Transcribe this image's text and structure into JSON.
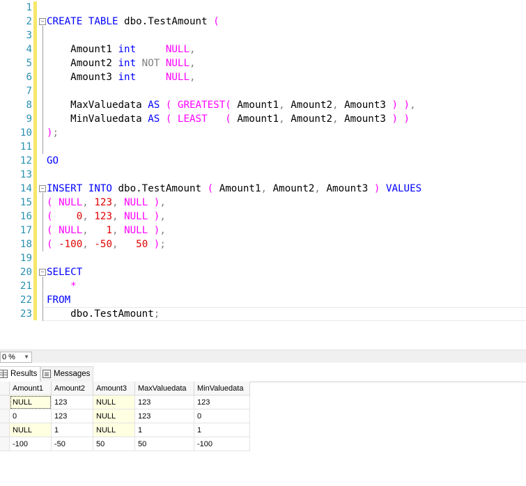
{
  "editor": {
    "lines": [
      {
        "n": "1",
        "fold": false,
        "tokens": []
      },
      {
        "n": "2",
        "fold": true,
        "tokens": [
          [
            "kw",
            "CREATE TABLE "
          ],
          [
            "id",
            "dbo.TestAmount "
          ],
          [
            "pk",
            "("
          ]
        ]
      },
      {
        "n": "3",
        "fold": false,
        "tokens": []
      },
      {
        "n": "4",
        "fold": false,
        "tokens": [
          [
            "id",
            "    Amount1 "
          ],
          [
            "kw",
            "int     "
          ],
          [
            "pk",
            "NULL"
          ],
          [
            "gr",
            ","
          ]
        ]
      },
      {
        "n": "5",
        "fold": false,
        "tokens": [
          [
            "id",
            "    Amount2 "
          ],
          [
            "kw",
            "int "
          ],
          [
            "gr",
            "NOT "
          ],
          [
            "pk",
            "NULL"
          ],
          [
            "gr",
            ","
          ]
        ]
      },
      {
        "n": "6",
        "fold": false,
        "tokens": [
          [
            "id",
            "    Amount3 "
          ],
          [
            "kw",
            "int     "
          ],
          [
            "pk",
            "NULL"
          ],
          [
            "gr",
            ","
          ]
        ]
      },
      {
        "n": "7",
        "fold": false,
        "tokens": []
      },
      {
        "n": "8",
        "fold": false,
        "tokens": [
          [
            "id",
            "    MaxValuedata "
          ],
          [
            "kw",
            "AS "
          ],
          [
            "pk",
            "( GREATEST( "
          ],
          [
            "id",
            "Amount1"
          ],
          [
            "gr",
            ", "
          ],
          [
            "id",
            "Amount2"
          ],
          [
            "gr",
            ", "
          ],
          [
            "id",
            "Amount3 "
          ],
          [
            "pk",
            ") )"
          ],
          [
            "gr",
            ","
          ]
        ]
      },
      {
        "n": "9",
        "fold": false,
        "tokens": [
          [
            "id",
            "    MinValuedata "
          ],
          [
            "kw",
            "AS "
          ],
          [
            "pk",
            "( LEAST   ( "
          ],
          [
            "id",
            "Amount1"
          ],
          [
            "gr",
            ", "
          ],
          [
            "id",
            "Amount2"
          ],
          [
            "gr",
            ", "
          ],
          [
            "id",
            "Amount3 "
          ],
          [
            "pk",
            ") )"
          ]
        ]
      },
      {
        "n": "10",
        "fold": false,
        "tokens": [
          [
            "pk",
            ")"
          ],
          [
            "gr",
            ";"
          ]
        ]
      },
      {
        "n": "11",
        "fold": false,
        "tokens": []
      },
      {
        "n": "12",
        "fold": false,
        "tokens": [
          [
            "kw",
            "GO"
          ]
        ]
      },
      {
        "n": "13",
        "fold": false,
        "tokens": []
      },
      {
        "n": "14",
        "fold": true,
        "tokens": [
          [
            "kw",
            "INSERT INTO "
          ],
          [
            "id",
            "dbo.TestAmount "
          ],
          [
            "pk",
            "( "
          ],
          [
            "id",
            "Amount1"
          ],
          [
            "gr",
            ", "
          ],
          [
            "id",
            "Amount2"
          ],
          [
            "gr",
            ", "
          ],
          [
            "id",
            "Amount3 "
          ],
          [
            "pk",
            ") "
          ],
          [
            "kw",
            "VALUES"
          ]
        ]
      },
      {
        "n": "15",
        "fold": false,
        "tokens": [
          [
            "pk",
            "( "
          ],
          [
            "pk",
            "NULL"
          ],
          [
            "gr",
            ", "
          ],
          [
            "nm",
            "123"
          ],
          [
            "gr",
            ", "
          ],
          [
            "pk",
            "NULL "
          ],
          [
            "pk",
            ")"
          ],
          [
            "gr",
            ","
          ]
        ]
      },
      {
        "n": "16",
        "fold": false,
        "tokens": [
          [
            "pk",
            "(    "
          ],
          [
            "nm",
            "0"
          ],
          [
            "gr",
            ", "
          ],
          [
            "nm",
            "123"
          ],
          [
            "gr",
            ", "
          ],
          [
            "pk",
            "NULL "
          ],
          [
            "pk",
            ")"
          ],
          [
            "gr",
            ","
          ]
        ]
      },
      {
        "n": "17",
        "fold": false,
        "tokens": [
          [
            "pk",
            "( "
          ],
          [
            "pk",
            "NULL"
          ],
          [
            "gr",
            ",   "
          ],
          [
            "nm",
            "1"
          ],
          [
            "gr",
            ", "
          ],
          [
            "pk",
            "NULL "
          ],
          [
            "pk",
            ")"
          ],
          [
            "gr",
            ","
          ]
        ]
      },
      {
        "n": "18",
        "fold": false,
        "tokens": [
          [
            "pk",
            "( "
          ],
          [
            "nm",
            "-100"
          ],
          [
            "gr",
            ", "
          ],
          [
            "nm",
            "-50"
          ],
          [
            "gr",
            ",   "
          ],
          [
            "nm",
            "50 "
          ],
          [
            "pk",
            ")"
          ],
          [
            "gr",
            ";"
          ]
        ]
      },
      {
        "n": "19",
        "fold": false,
        "tokens": []
      },
      {
        "n": "20",
        "fold": true,
        "tokens": [
          [
            "kw",
            "SELECT"
          ]
        ]
      },
      {
        "n": "21",
        "fold": false,
        "tokens": [
          [
            "pk",
            "    *"
          ]
        ]
      },
      {
        "n": "22",
        "fold": false,
        "tokens": [
          [
            "kw",
            "FROM"
          ]
        ]
      },
      {
        "n": "23",
        "fold": false,
        "tokens": [
          [
            "id",
            "    dbo.TestAmount"
          ],
          [
            "gr",
            ";"
          ]
        ]
      }
    ]
  },
  "zoom": {
    "value": "0 %"
  },
  "tabs": {
    "results": "Results",
    "messages": "Messages"
  },
  "grid": {
    "columns": [
      "Amount1",
      "Amount2",
      "Amount3",
      "MaxValuedata",
      "MinValuedata"
    ],
    "rows": [
      [
        "NULL",
        "123",
        "NULL",
        "123",
        "123"
      ],
      [
        "0",
        "123",
        "NULL",
        "123",
        "0"
      ],
      [
        "NULL",
        "1",
        "NULL",
        "1",
        "1"
      ],
      [
        "-100",
        "-50",
        "50",
        "50",
        "-100"
      ]
    ]
  },
  "colors": {
    "keyword": "#0000ff",
    "string": "#ff00ff",
    "number": "#e00000",
    "gray": "#808080",
    "linenumber": "#2b91af",
    "changebar": "#f6e76a",
    "nullcell": "#ffffe1"
  }
}
